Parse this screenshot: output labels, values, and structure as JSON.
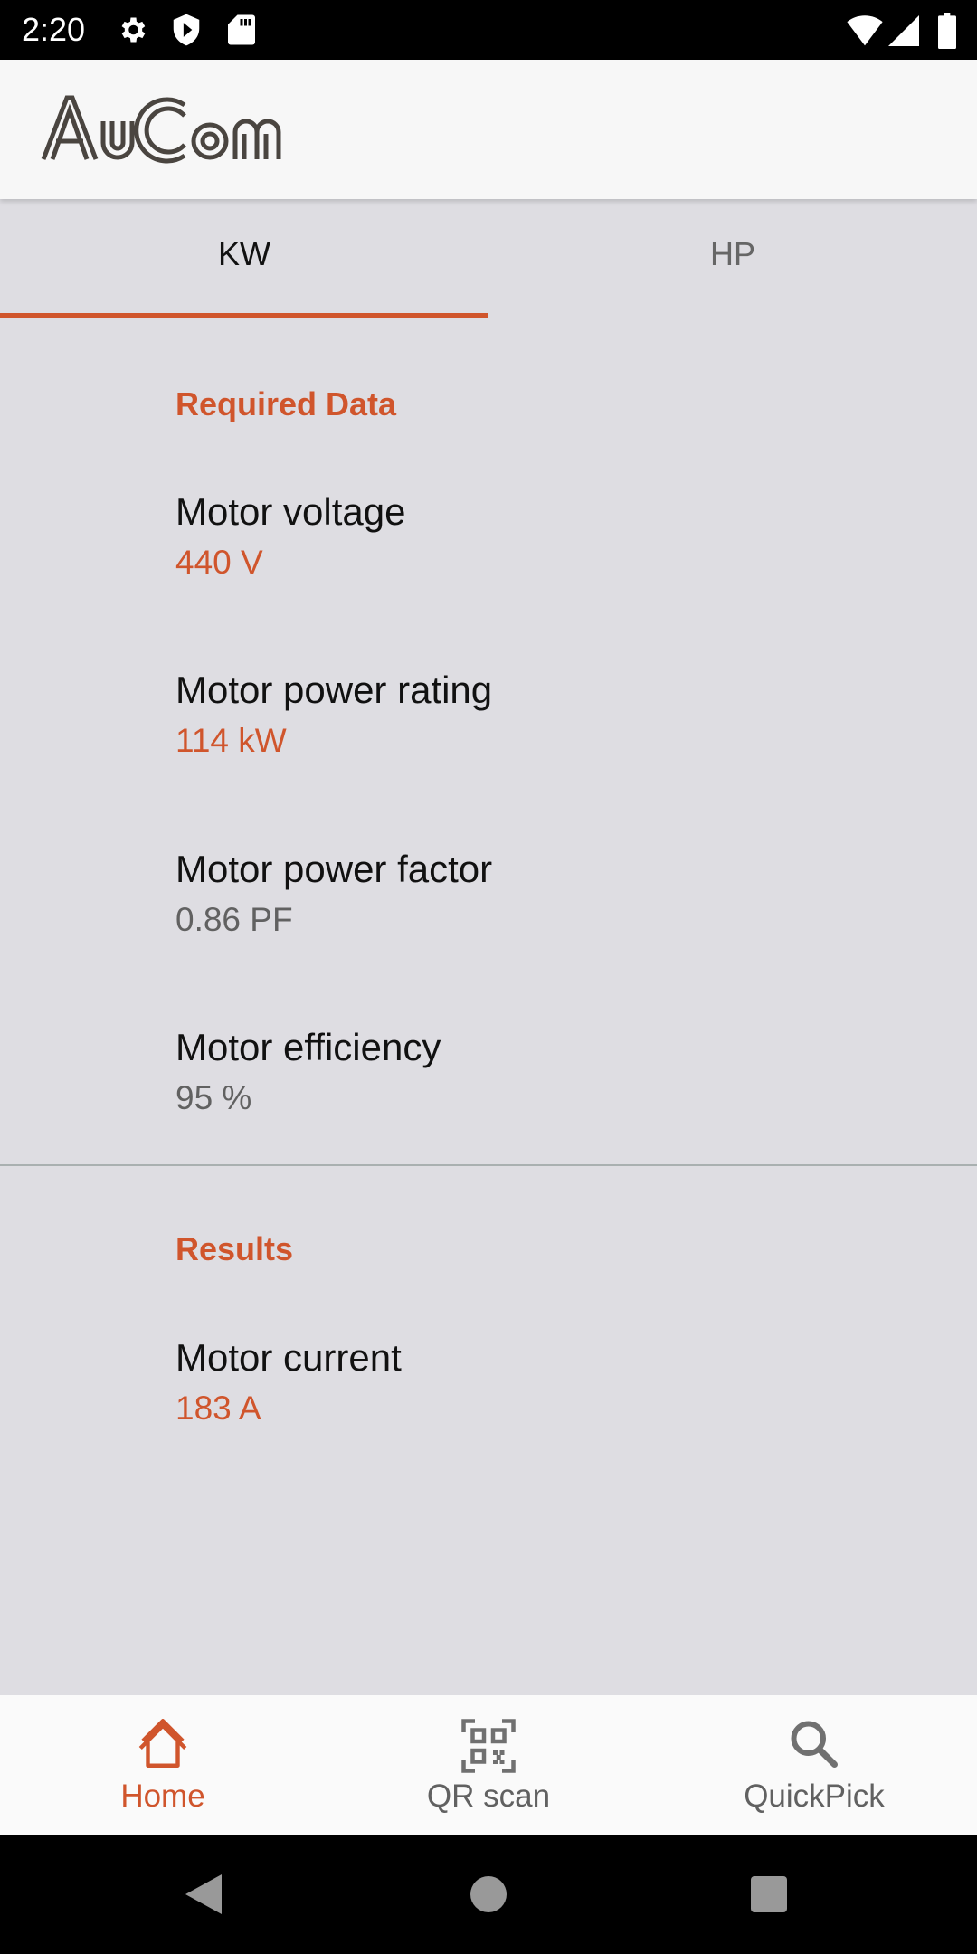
{
  "status_bar": {
    "time": "2:20",
    "icons": [
      "gear-icon",
      "shield-play-icon",
      "sd-card-icon",
      "wifi-icon",
      "signal-icon",
      "battery-icon"
    ]
  },
  "app_bar": {
    "logo_text": "AuCom"
  },
  "tabs": [
    {
      "label": "KW",
      "active": true
    },
    {
      "label": "HP",
      "active": false
    }
  ],
  "required": {
    "title": "Required Data",
    "items": [
      {
        "label": "Motor voltage",
        "value": "440 V",
        "value_color": "orange"
      },
      {
        "label": "Motor power rating",
        "value": "114 kW",
        "value_color": "orange"
      },
      {
        "label": "Motor power factor",
        "value": "0.86 PF",
        "value_color": "grey"
      },
      {
        "label": "Motor efficiency",
        "value": "95 %",
        "value_color": "grey"
      }
    ]
  },
  "results": {
    "title": "Results",
    "items": [
      {
        "label": "Motor current",
        "value": "183 A",
        "value_color": "orange"
      }
    ]
  },
  "bottom_nav": [
    {
      "label": "Home",
      "icon": "home-icon",
      "active": true
    },
    {
      "label": "QR scan",
      "icon": "qr-code-icon",
      "active": false
    },
    {
      "label": "QuickPick",
      "icon": "search-icon",
      "active": false
    }
  ],
  "colors": {
    "accent": "#d0552c",
    "background": "#dedde2",
    "app_bar": "#f7f7f7",
    "inactive": "#666666"
  }
}
